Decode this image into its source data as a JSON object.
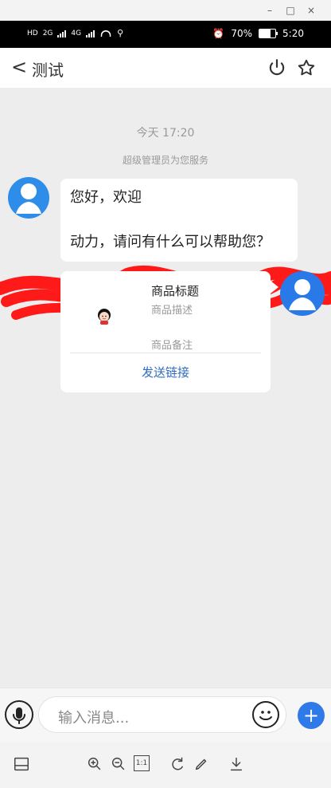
{
  "window": {
    "controls": [
      "–",
      "□",
      "×"
    ]
  },
  "status_bar": {
    "left": [
      "HD",
      "2G",
      "4G"
    ],
    "alarm_icon": "alarm-icon",
    "battery_percent": "70%",
    "time": "5:20"
  },
  "header": {
    "back_label": "<",
    "title": "测试"
  },
  "chat": {
    "time_label": "今天 17:20",
    "system_label": "超级管理员为您服务",
    "message_line1": "您好，欢迎",
    "message_line2": "动力，请问有什么可以帮助您？",
    "card": {
      "title": "商品标题",
      "description": "商品描述",
      "note": "商品备注",
      "send_link": "发送链接"
    }
  },
  "input_bar": {
    "placeholder": "输入消息..."
  },
  "toolbar": {
    "zoom_fit": "1:1"
  },
  "colors": {
    "chat_bg": "#ededed",
    "link": "#2f6bbd",
    "primary": "#2f79e8"
  }
}
